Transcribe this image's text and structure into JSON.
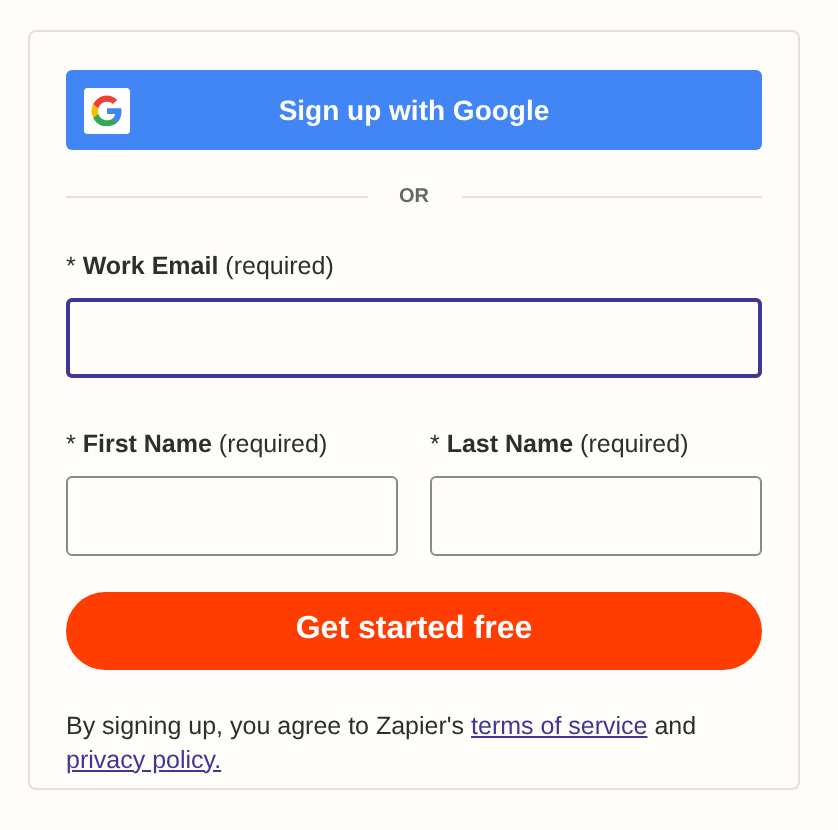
{
  "google_button": {
    "label": "Sign up with Google"
  },
  "divider": {
    "label": "OR"
  },
  "field_rows": [
    [
      {
        "label": "* **Work Email** (required)",
        "focused": true
      }
    ],
    [
      {
        "label": "* **First Name** (required)",
        "focused": false
      },
      {
        "label": "* **Last Name** (required)",
        "focused": false
      }
    ]
  ],
  "submit_button": {
    "label": "Get started free"
  },
  "consent": [
    {
      "kind": "text",
      "text": "By signing up, you agree to Zapier's "
    },
    {
      "kind": "link",
      "text": "terms of service"
    },
    {
      "kind": "text",
      "text": " and "
    },
    {
      "kind": "link",
      "text": "privacy policy."
    }
  ]
}
